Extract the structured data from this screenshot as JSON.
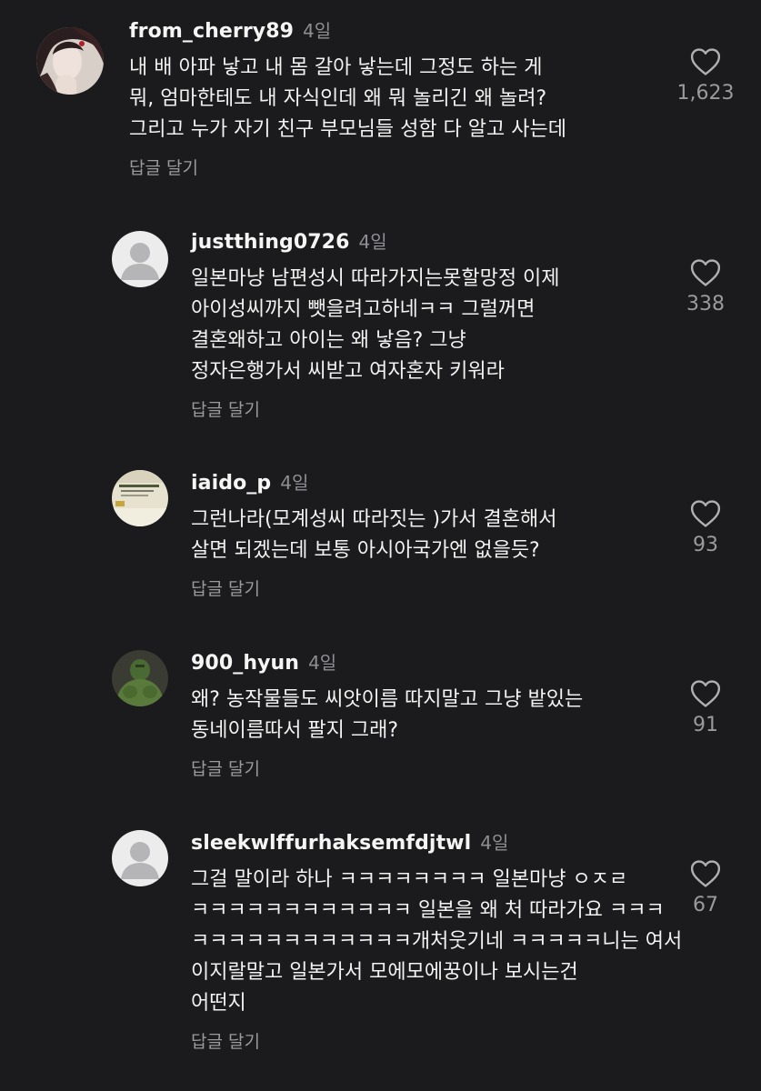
{
  "comments": [
    {
      "username": "from_cherry89",
      "time": "4일",
      "avatar": "girl-photo-avatar",
      "lines": [
        "내 배 아파 낳고 내 몸 갈아 낳는데 그정도 하는 게",
        "뭐, 엄마한테도 내 자식인데 왜 뭐 놀리긴 왜 놀려?",
        "그리고 누가 자기 친구 부모님들 성함 다 알고 사는데"
      ],
      "reply_label": "답글 달기",
      "likes": "1,623"
    },
    {
      "username": "justthing0726",
      "time": "4일",
      "avatar": "default-user-avatar",
      "lines": [
        "일본마냥 남편성시 따라가지는못할망정 이제",
        "아이성씨까지 뺏을려고하네ㅋㅋ 그럴꺼면",
        "결혼왜하고 아이는 왜 낳음? 그냥",
        "정자은행가서 씨받고 여자혼자 키워라"
      ],
      "reply_label": "답글 달기",
      "likes": "338"
    },
    {
      "username": "iaido_p",
      "time": "4일",
      "avatar": "document-photo-avatar",
      "lines": [
        "그런나라(모계성씨 따라짓는 )가서 결혼해서",
        "살면 되겠는데 보통 아시아국가엔 없을듯?"
      ],
      "reply_label": "답글 달기",
      "likes": "93"
    },
    {
      "username": "900_hyun",
      "time": "4일",
      "avatar": "hulk-photo-avatar",
      "lines": [
        "왜? 농작물들도 씨앗이름 따지말고 그냥 밭있는",
        "동네이름따서 팔지 그래?"
      ],
      "reply_label": "답글 달기",
      "likes": "91"
    },
    {
      "username": "sleekwlffurhaksemfdjtwl",
      "time": "4일",
      "avatar": "default-user-avatar",
      "lines": [
        "그걸 말이라 하나 ㅋㅋㅋㅋㅋㅋㅋㅋ 일본마냥 ㅇㅈㄹ",
        "ㅋㅋㅋㅋㅋㅋㅋㅋㅋㅋㅋㅋ 일본을 왜 처 따라가요 ㅋㅋㅋ",
        "ㅋㅋㅋㅋㅋㅋㅋㅋㅋㅋㅋㅋ개처웃기네 ㅋㅋㅋㅋㅋ니는 여서",
        "이지랄말고 일본가서 모에모에꿍이나 보시는건",
        "어떤지"
      ],
      "reply_label": "답글 달기",
      "likes": "67"
    }
  ],
  "icons": {
    "like": "heart-outline-icon"
  },
  "colors": {
    "background": "#1b1b1d",
    "text": "#f2f2f2",
    "secondary": "#9a9a9e"
  }
}
